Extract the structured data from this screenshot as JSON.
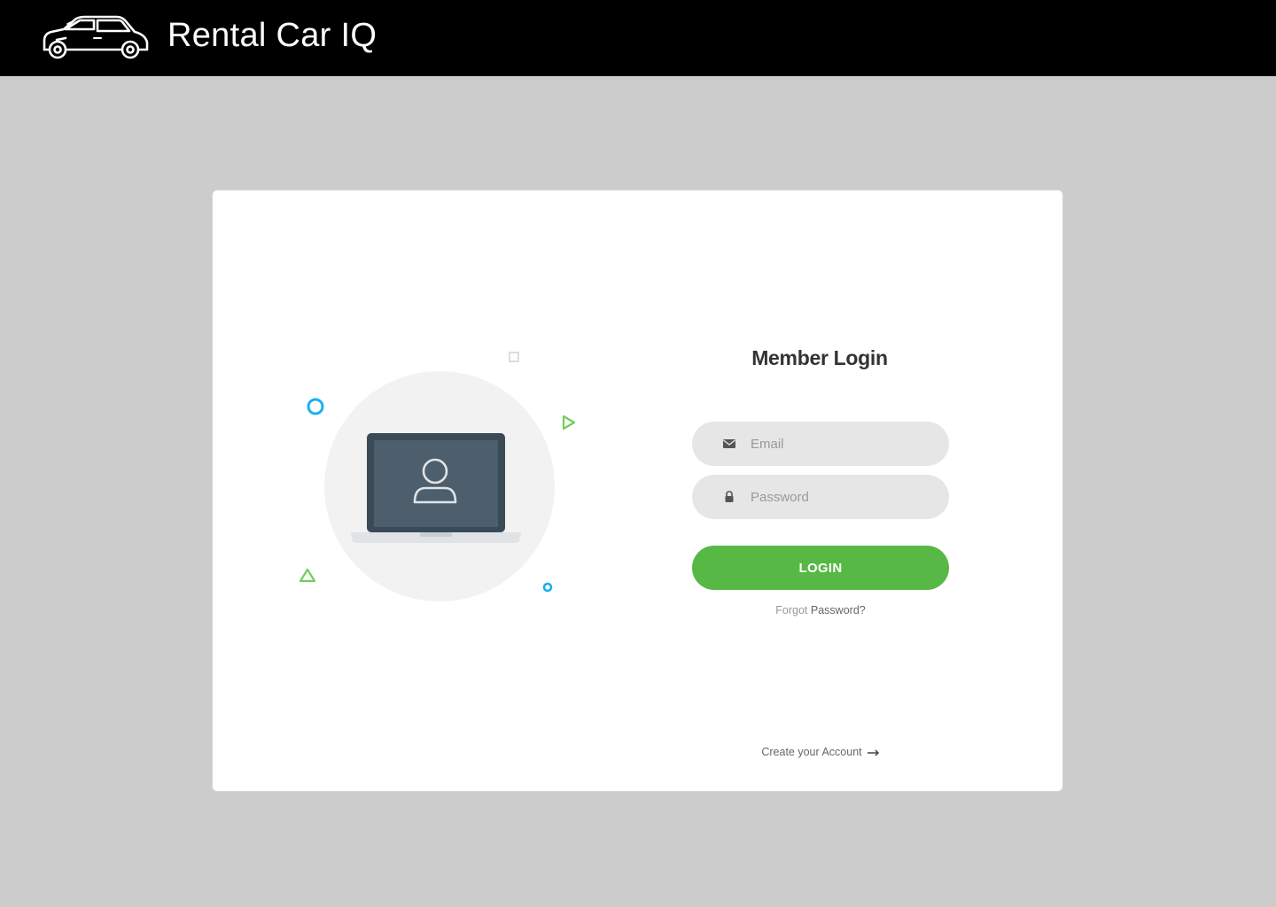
{
  "header": {
    "title": "Rental Car IQ",
    "logo_icon": "car-icon",
    "background": "#000000"
  },
  "login": {
    "title": "Member Login",
    "email": {
      "placeholder": "Email",
      "value": "",
      "icon": "envelope-icon"
    },
    "password": {
      "placeholder": "Password",
      "value": "",
      "icon": "lock-icon"
    },
    "login_label": "LOGIN",
    "forgot_prefix": "Forgot",
    "forgot_link": "Password?",
    "create_account": "Create your Account",
    "create_account_icon": "arrow-right-icon"
  },
  "colors": {
    "accent": "#57b846",
    "field_bg": "#e6e6e6",
    "page_bg": "#cccccc",
    "shape_blue": "#1ab0f0",
    "shape_green": "#6fcf5a"
  },
  "illustration": {
    "icon": "laptop-user-icon"
  }
}
